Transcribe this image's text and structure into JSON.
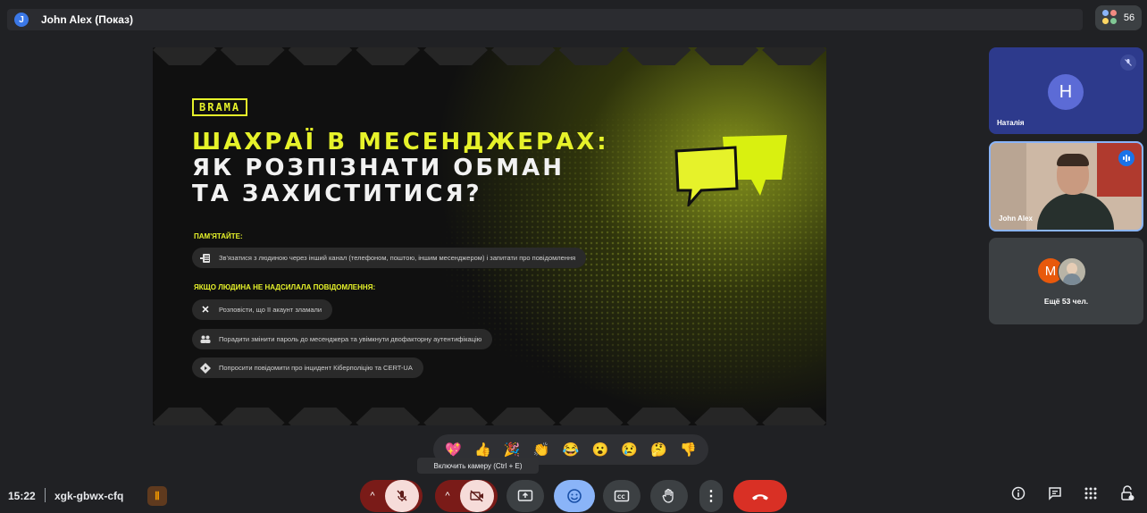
{
  "top_bar": {
    "presenter_initial": "J",
    "presenter_label": "John Alex (Показ)",
    "participant_count": "56"
  },
  "slide": {
    "brand": "BRAMA",
    "title_line1": "ШАХРАЇ В МЕСЕНДЖЕРАХ:",
    "title_line2": "ЯК РОЗПІЗНАТИ ОБМАН",
    "title_line3": "ТА ЗАХИСТИТИСЯ?",
    "remember_label": "ПАМ'ЯТАЙТЕ:",
    "remember_item": "Зв'язатися з людиною через інший канал (телефоном, поштою, іншим месенджером) і запитати про повідомлення",
    "if_not_sent_label": "ЯКЩО ЛЮДИНА НЕ НАДСИЛАЛА ПОВІДОМЛЕННЯ:",
    "steps": [
      {
        "icon": "close-icon",
        "text": "Розповісти, що її акаунт зламали"
      },
      {
        "icon": "people-icon",
        "text": "Порадити змінити пароль до месенджера та увімкнути двофакторну аутентифікацію"
      },
      {
        "icon": "diamond-arrow-icon",
        "text": "Попросити повідомити про інцидент Кіберполіцію та CERT-UA"
      }
    ]
  },
  "participants": {
    "tile1_initial": "H",
    "tile1_name": "Наталія",
    "tile2_name": "John Alex",
    "more_initial": "M",
    "more_label": "Ещё 53 чел."
  },
  "reactions": [
    "💖",
    "👍",
    "🎉",
    "👏",
    "😂",
    "😮",
    "😢",
    "🤔",
    "👎"
  ],
  "tooltip": "Включить камеру (Ctrl + E)",
  "bottom": {
    "time": "15:22",
    "meeting_code": "xgk-gbwx-cfq"
  },
  "colors": {
    "accent_yellow": "#e6f22a",
    "end_call_red": "#d93025",
    "reaction_blue": "#8ab4f8"
  }
}
